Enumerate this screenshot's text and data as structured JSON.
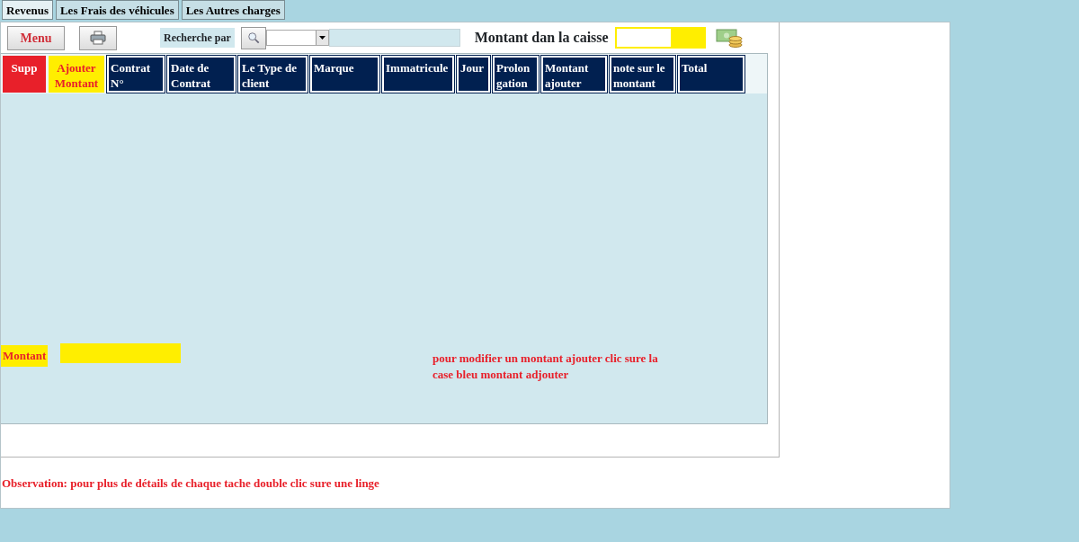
{
  "tabs": [
    {
      "label": "Revenus",
      "selected": true
    },
    {
      "label": "Les Frais des véhicules",
      "selected": false
    },
    {
      "label": "Les Autres charges",
      "selected": false
    }
  ],
  "toolbar": {
    "menu_button": "Menu",
    "search_label": "Recherche par",
    "caisse_label": "Montant dan la caisse"
  },
  "table": {
    "columns": [
      {
        "label": "Supp",
        "kind": "delete"
      },
      {
        "label": "Ajouter Montant",
        "kind": "add"
      },
      {
        "label": "Contrat N°",
        "kind": "normal"
      },
      {
        "label": "Date de Contrat",
        "kind": "normal"
      },
      {
        "label": "Le Type de client",
        "kind": "normal"
      },
      {
        "label": "Marque",
        "kind": "normal"
      },
      {
        "label": "Immatricule",
        "kind": "normal"
      },
      {
        "label": "Jour",
        "kind": "normal"
      },
      {
        "label": "Prolon gation",
        "kind": "normal"
      },
      {
        "label": "Montant ajouter",
        "kind": "normal"
      },
      {
        "label": "note sur le montant",
        "kind": "normal"
      },
      {
        "label": "Total",
        "kind": "normal"
      }
    ]
  },
  "montant_label": "Montant",
  "hint": "pour modifier un montant ajouter clic sure la case bleu  montant adjouter",
  "observation": "Observation: pour plus de détails de chaque tache double clic sure une linge"
}
